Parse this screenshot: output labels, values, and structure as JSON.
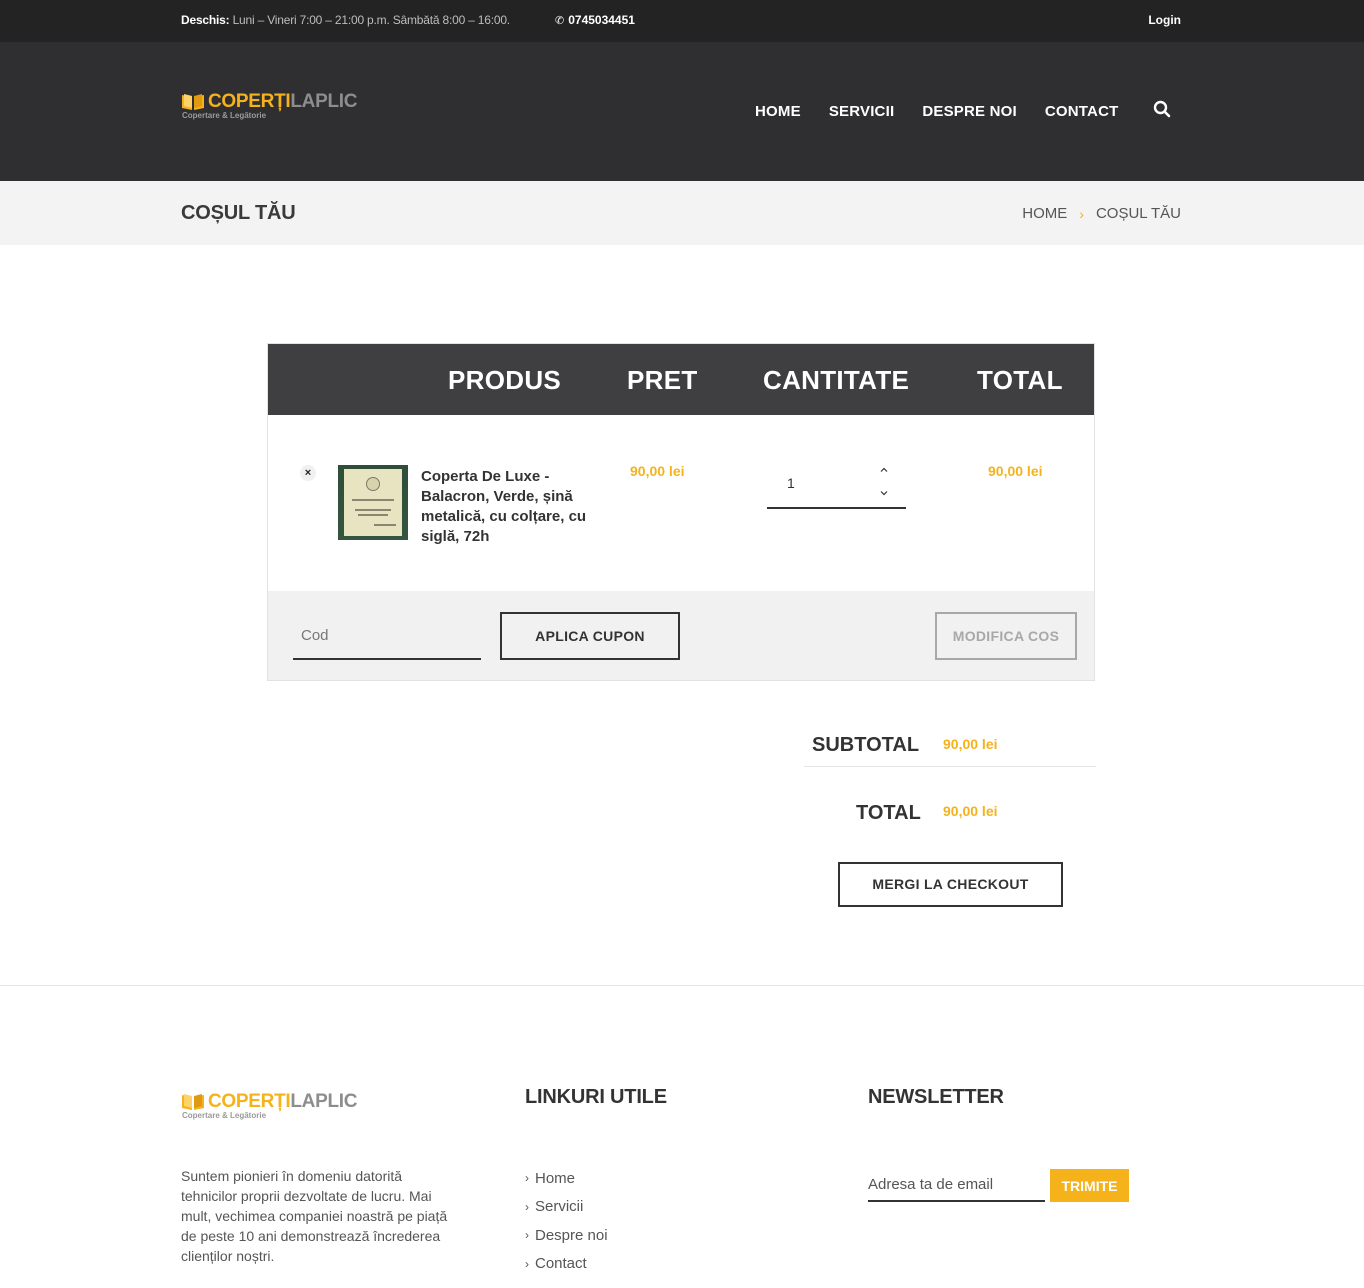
{
  "topbar": {
    "open_label": "Deschis:",
    "hours": "Luni – Vineri 7:00 – 21:00 p.m. Sâmbătă 8:00 – 16:00.",
    "phone": "0745034451",
    "login": "Login"
  },
  "brand": {
    "word1": "COPERȚI",
    "word2": "LAPLIC",
    "tagline": "Copertare & Legătorie",
    "accent_color": "#f5b21b"
  },
  "nav": {
    "items": [
      {
        "label": "HOME"
      },
      {
        "label": "SERVICII"
      },
      {
        "label": "DESPRE NOI"
      },
      {
        "label": "CONTACT"
      }
    ],
    "search_icon": "search-icon"
  },
  "page": {
    "title": "COȘUL TĂU",
    "breadcrumb": {
      "home": "HOME",
      "separator": "›",
      "current": "COȘUL TĂU"
    }
  },
  "cart": {
    "headers": {
      "product": "PRODUS",
      "price": "PRET",
      "quantity": "CANTITATE",
      "total": "TOTAL"
    },
    "items": [
      {
        "remove_icon": "×",
        "name": "Coperta De Luxe - Balacron, Verde, șină metalică, cu colțare, cu siglă, 72h",
        "price": "90,00 lei",
        "quantity": "1",
        "total": "90,00 lei"
      }
    ],
    "coupon": {
      "placeholder": "Cod",
      "value": "",
      "apply_label": "APLICA CUPON"
    },
    "update_label": "MODIFICA COS"
  },
  "totals": {
    "subtotal_label": "SUBTOTAL",
    "subtotal_value": "90,00 lei",
    "total_label": "TOTAL",
    "total_value": "90,00 lei",
    "checkout_label": "MERGI LA CHECKOUT"
  },
  "footer": {
    "about": "Suntem pionieri în domeniu datorită tehnicilor proprii dezvoltate de lucru. Mai mult, vechimea companiei noastră pe piață de peste 10 ani demonstrează încrederea clienților noștri.",
    "links_heading": "LINKURI UTILE",
    "links": [
      "Home",
      "Servicii",
      "Despre noi",
      "Contact"
    ],
    "newsletter_heading": "NEWSLETTER",
    "newsletter_placeholder": "Adresa ta de email",
    "newsletter_button": "TRIMITE"
  }
}
